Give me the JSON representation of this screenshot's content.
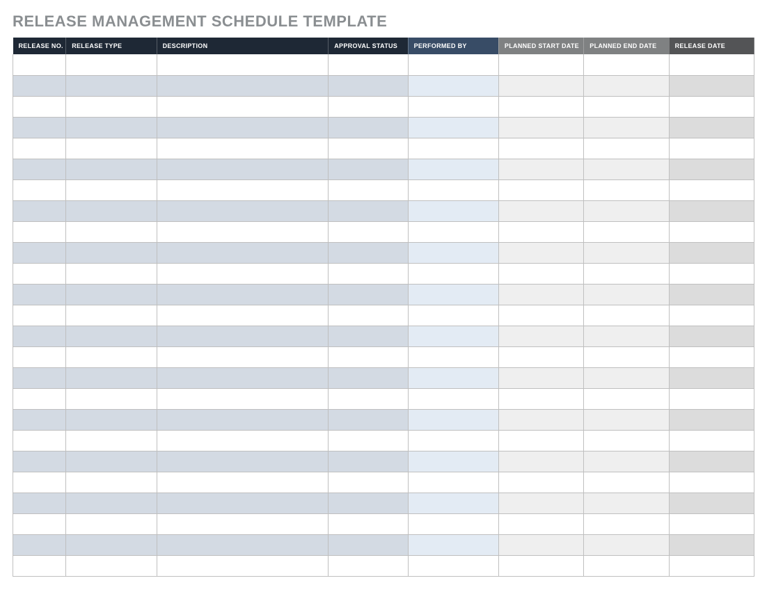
{
  "title": "RELEASE MANAGEMENT SCHEDULE TEMPLATE",
  "columns": [
    "RELEASE NO.",
    "RELEASE TYPE",
    "DESCRIPTION",
    "APPROVAL STATUS",
    "PERFORMED BY",
    "PLANNED START DATE",
    "PLANNED END DATE",
    "RELEASE DATE"
  ],
  "rows": [
    {
      "release_no": "",
      "release_type": "",
      "description": "",
      "approval_status": "",
      "performed_by": "",
      "planned_start_date": "",
      "planned_end_date": "",
      "release_date": ""
    },
    {
      "release_no": "",
      "release_type": "",
      "description": "",
      "approval_status": "",
      "performed_by": "",
      "planned_start_date": "",
      "planned_end_date": "",
      "release_date": ""
    },
    {
      "release_no": "",
      "release_type": "",
      "description": "",
      "approval_status": "",
      "performed_by": "",
      "planned_start_date": "",
      "planned_end_date": "",
      "release_date": ""
    },
    {
      "release_no": "",
      "release_type": "",
      "description": "",
      "approval_status": "",
      "performed_by": "",
      "planned_start_date": "",
      "planned_end_date": "",
      "release_date": ""
    },
    {
      "release_no": "",
      "release_type": "",
      "description": "",
      "approval_status": "",
      "performed_by": "",
      "planned_start_date": "",
      "planned_end_date": "",
      "release_date": ""
    },
    {
      "release_no": "",
      "release_type": "",
      "description": "",
      "approval_status": "",
      "performed_by": "",
      "planned_start_date": "",
      "planned_end_date": "",
      "release_date": ""
    },
    {
      "release_no": "",
      "release_type": "",
      "description": "",
      "approval_status": "",
      "performed_by": "",
      "planned_start_date": "",
      "planned_end_date": "",
      "release_date": ""
    },
    {
      "release_no": "",
      "release_type": "",
      "description": "",
      "approval_status": "",
      "performed_by": "",
      "planned_start_date": "",
      "planned_end_date": "",
      "release_date": ""
    },
    {
      "release_no": "",
      "release_type": "",
      "description": "",
      "approval_status": "",
      "performed_by": "",
      "planned_start_date": "",
      "planned_end_date": "",
      "release_date": ""
    },
    {
      "release_no": "",
      "release_type": "",
      "description": "",
      "approval_status": "",
      "performed_by": "",
      "planned_start_date": "",
      "planned_end_date": "",
      "release_date": ""
    },
    {
      "release_no": "",
      "release_type": "",
      "description": "",
      "approval_status": "",
      "performed_by": "",
      "planned_start_date": "",
      "planned_end_date": "",
      "release_date": ""
    },
    {
      "release_no": "",
      "release_type": "",
      "description": "",
      "approval_status": "",
      "performed_by": "",
      "planned_start_date": "",
      "planned_end_date": "",
      "release_date": ""
    },
    {
      "release_no": "",
      "release_type": "",
      "description": "",
      "approval_status": "",
      "performed_by": "",
      "planned_start_date": "",
      "planned_end_date": "",
      "release_date": ""
    },
    {
      "release_no": "",
      "release_type": "",
      "description": "",
      "approval_status": "",
      "performed_by": "",
      "planned_start_date": "",
      "planned_end_date": "",
      "release_date": ""
    },
    {
      "release_no": "",
      "release_type": "",
      "description": "",
      "approval_status": "",
      "performed_by": "",
      "planned_start_date": "",
      "planned_end_date": "",
      "release_date": ""
    },
    {
      "release_no": "",
      "release_type": "",
      "description": "",
      "approval_status": "",
      "performed_by": "",
      "planned_start_date": "",
      "planned_end_date": "",
      "release_date": ""
    },
    {
      "release_no": "",
      "release_type": "",
      "description": "",
      "approval_status": "",
      "performed_by": "",
      "planned_start_date": "",
      "planned_end_date": "",
      "release_date": ""
    },
    {
      "release_no": "",
      "release_type": "",
      "description": "",
      "approval_status": "",
      "performed_by": "",
      "planned_start_date": "",
      "planned_end_date": "",
      "release_date": ""
    },
    {
      "release_no": "",
      "release_type": "",
      "description": "",
      "approval_status": "",
      "performed_by": "",
      "planned_start_date": "",
      "planned_end_date": "",
      "release_date": ""
    },
    {
      "release_no": "",
      "release_type": "",
      "description": "",
      "approval_status": "",
      "performed_by": "",
      "planned_start_date": "",
      "planned_end_date": "",
      "release_date": ""
    },
    {
      "release_no": "",
      "release_type": "",
      "description": "",
      "approval_status": "",
      "performed_by": "",
      "planned_start_date": "",
      "planned_end_date": "",
      "release_date": ""
    },
    {
      "release_no": "",
      "release_type": "",
      "description": "",
      "approval_status": "",
      "performed_by": "",
      "planned_start_date": "",
      "planned_end_date": "",
      "release_date": ""
    },
    {
      "release_no": "",
      "release_type": "",
      "description": "",
      "approval_status": "",
      "performed_by": "",
      "planned_start_date": "",
      "planned_end_date": "",
      "release_date": ""
    },
    {
      "release_no": "",
      "release_type": "",
      "description": "",
      "approval_status": "",
      "performed_by": "",
      "planned_start_date": "",
      "planned_end_date": "",
      "release_date": ""
    },
    {
      "release_no": "",
      "release_type": "",
      "description": "",
      "approval_status": "",
      "performed_by": "",
      "planned_start_date": "",
      "planned_end_date": "",
      "release_date": ""
    }
  ]
}
